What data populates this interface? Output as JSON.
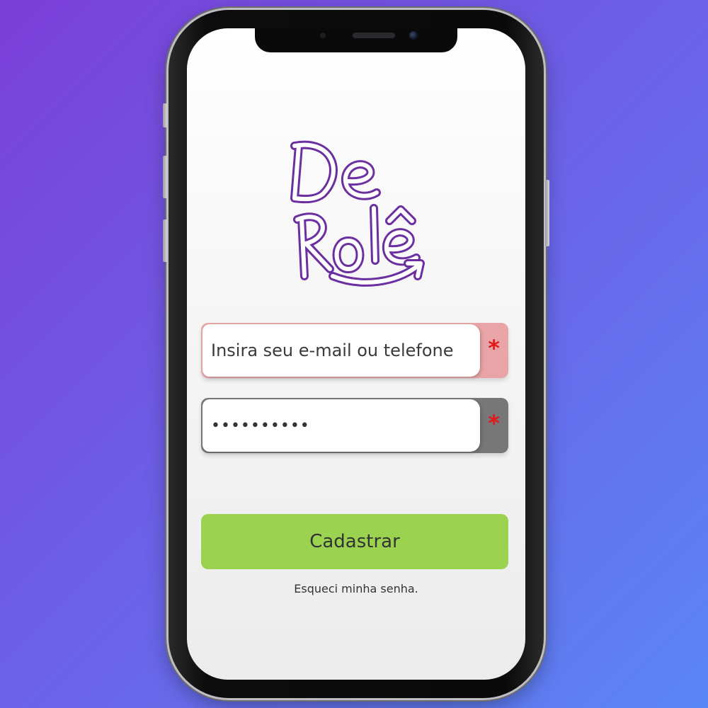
{
  "app": {
    "logo_alt": "De Rolê"
  },
  "login": {
    "email_placeholder": "Insira seu e-mail ou telefone",
    "email_value": "",
    "password_value": "••••••••••",
    "required_marker": "*",
    "submit_label": "Cadastrar",
    "forgot_label": "Esqueci minha senha."
  },
  "colors": {
    "accent_green": "#9bd351",
    "logo_purple": "#6b2fa0",
    "required_red": "#e11a1a",
    "email_field_border": "#e8a4a6",
    "password_field_border": "#777777"
  },
  "icons": {
    "logo": "de-role-logo-icon"
  }
}
